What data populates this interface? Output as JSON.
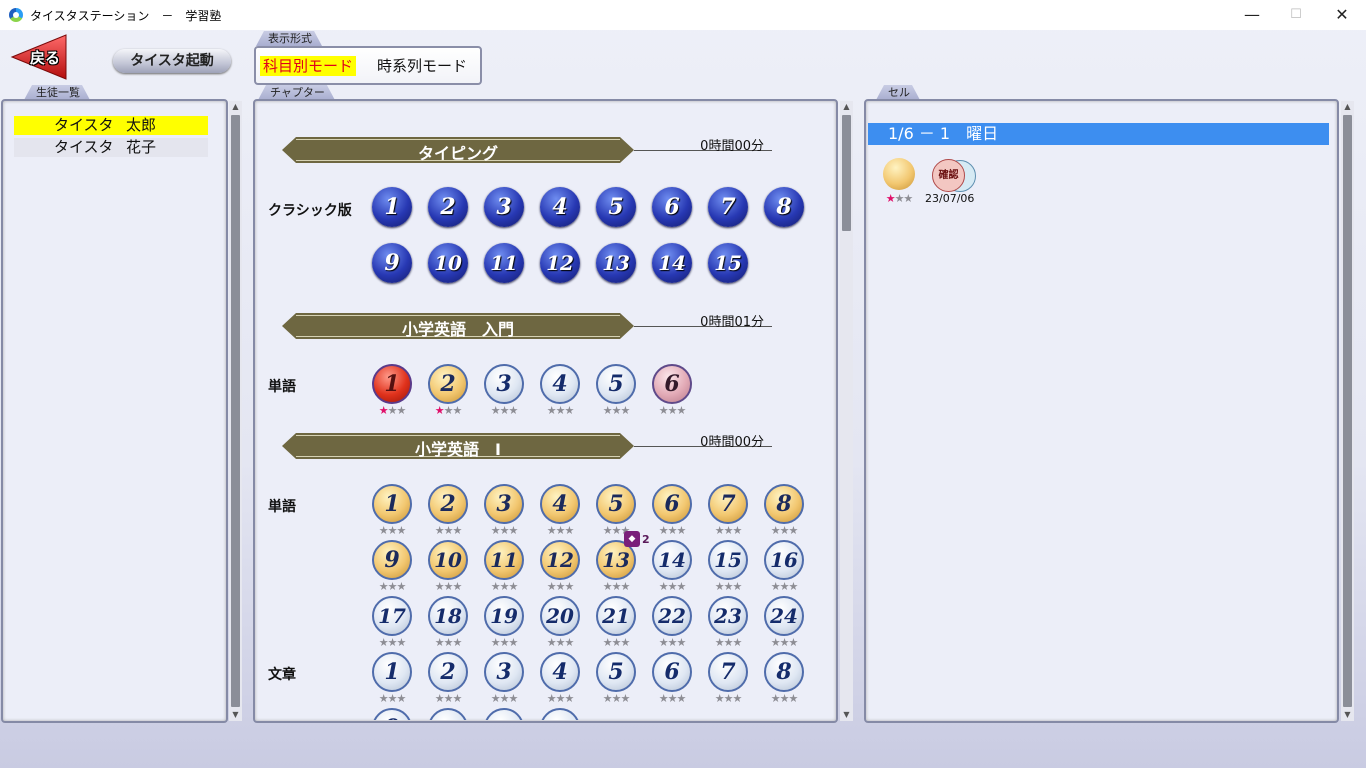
{
  "window": {
    "title": "タイスタステーション　－　学習塾",
    "minimize": "—",
    "maximize": "☐",
    "close": "✕"
  },
  "toolbar": {
    "back_label": "戻る",
    "launch_label": "タイスタ起動"
  },
  "display_mode": {
    "tab": "表示形式",
    "options": [
      "科目別モード",
      "時系列モード"
    ],
    "selected": "科目別モード"
  },
  "students": {
    "tab": "生徒一覧",
    "items": [
      {
        "name": "タイスタ",
        "given": "太郎",
        "selected": true
      },
      {
        "name": "タイスタ",
        "given": "花子",
        "selected": false
      }
    ]
  },
  "chapter": {
    "tab": "チャプター",
    "sections": [
      {
        "title": "タイピング",
        "time": "0時間00分",
        "rows": [
          {
            "label": "クラシック版",
            "style": "blue",
            "items": [
              "1",
              "2",
              "3",
              "4",
              "5",
              "6",
              "7",
              "8",
              "9",
              "10",
              "11",
              "12",
              "13",
              "14",
              "15"
            ]
          }
        ]
      },
      {
        "title": "小学英語　入門",
        "time": "0時間01分",
        "rows": [
          {
            "label": "単語",
            "items": [
              {
                "n": "1",
                "style": "red",
                "stars": 1
              },
              {
                "n": "2",
                "style": "gold",
                "stars": 1
              },
              {
                "n": "3",
                "style": "silver",
                "stars": 0
              },
              {
                "n": "4",
                "style": "silver",
                "stars": 0
              },
              {
                "n": "5",
                "style": "silver",
                "stars": 0
              },
              {
                "n": "6",
                "style": "pink",
                "stars": 0
              }
            ]
          }
        ]
      },
      {
        "title": "小学英語　Ⅰ",
        "time": "0時間00分",
        "rows": [
          {
            "label": "単語",
            "items": [
              {
                "n": "1",
                "style": "gold",
                "stars": 0
              },
              {
                "n": "2",
                "style": "gold",
                "stars": 0
              },
              {
                "n": "3",
                "style": "gold",
                "stars": 0
              },
              {
                "n": "4",
                "style": "gold",
                "stars": 0
              },
              {
                "n": "5",
                "style": "gold",
                "stars": 0
              },
              {
                "n": "6",
                "style": "gold",
                "stars": 0
              },
              {
                "n": "7",
                "style": "gold",
                "stars": 0
              },
              {
                "n": "8",
                "style": "gold",
                "stars": 0
              },
              {
                "n": "9",
                "style": "gold",
                "stars": 0
              },
              {
                "n": "10",
                "style": "gold",
                "stars": 0
              },
              {
                "n": "11",
                "style": "gold",
                "stars": 0
              },
              {
                "n": "12",
                "style": "gold",
                "stars": 0
              },
              {
                "n": "13",
                "style": "gold",
                "stars": 0,
                "badge": "2"
              },
              {
                "n": "14",
                "style": "silver",
                "stars": 0
              },
              {
                "n": "15",
                "style": "silver",
                "stars": 0
              },
              {
                "n": "16",
                "style": "silver",
                "stars": 0
              },
              {
                "n": "17",
                "style": "silver",
                "stars": 0
              },
              {
                "n": "18",
                "style": "silver",
                "stars": 0
              },
              {
                "n": "19",
                "style": "silver",
                "stars": 0
              },
              {
                "n": "20",
                "style": "silver",
                "stars": 0
              },
              {
                "n": "21",
                "style": "silver",
                "stars": 0
              },
              {
                "n": "22",
                "style": "silver",
                "stars": 0
              },
              {
                "n": "23",
                "style": "silver",
                "stars": 0
              },
              {
                "n": "24",
                "style": "silver",
                "stars": 0
              }
            ]
          },
          {
            "label": "文章",
            "items": [
              {
                "n": "1",
                "style": "silver",
                "stars": 0
              },
              {
                "n": "2",
                "style": "silver",
                "stars": 0
              },
              {
                "n": "3",
                "style": "silver",
                "stars": 0
              },
              {
                "n": "4",
                "style": "silver",
                "stars": 0
              },
              {
                "n": "5",
                "style": "silver",
                "stars": 0
              },
              {
                "n": "6",
                "style": "silver",
                "stars": 0
              },
              {
                "n": "7",
                "style": "silver",
                "stars": 0
              },
              {
                "n": "8",
                "style": "silver",
                "stars": 0
              }
            ]
          }
        ]
      }
    ]
  },
  "cell": {
    "tab": "セル",
    "header": "1/6 － 1　曜日",
    "entry": {
      "stars": 1,
      "date": "23/07/06",
      "badge_text": "確認"
    }
  },
  "colors": {
    "highlight": "#ffff00",
    "selected_text": "#e0001a",
    "cell_header": "#3d8ef0",
    "banner": "#6e6741",
    "star_on": "#e0106a"
  }
}
